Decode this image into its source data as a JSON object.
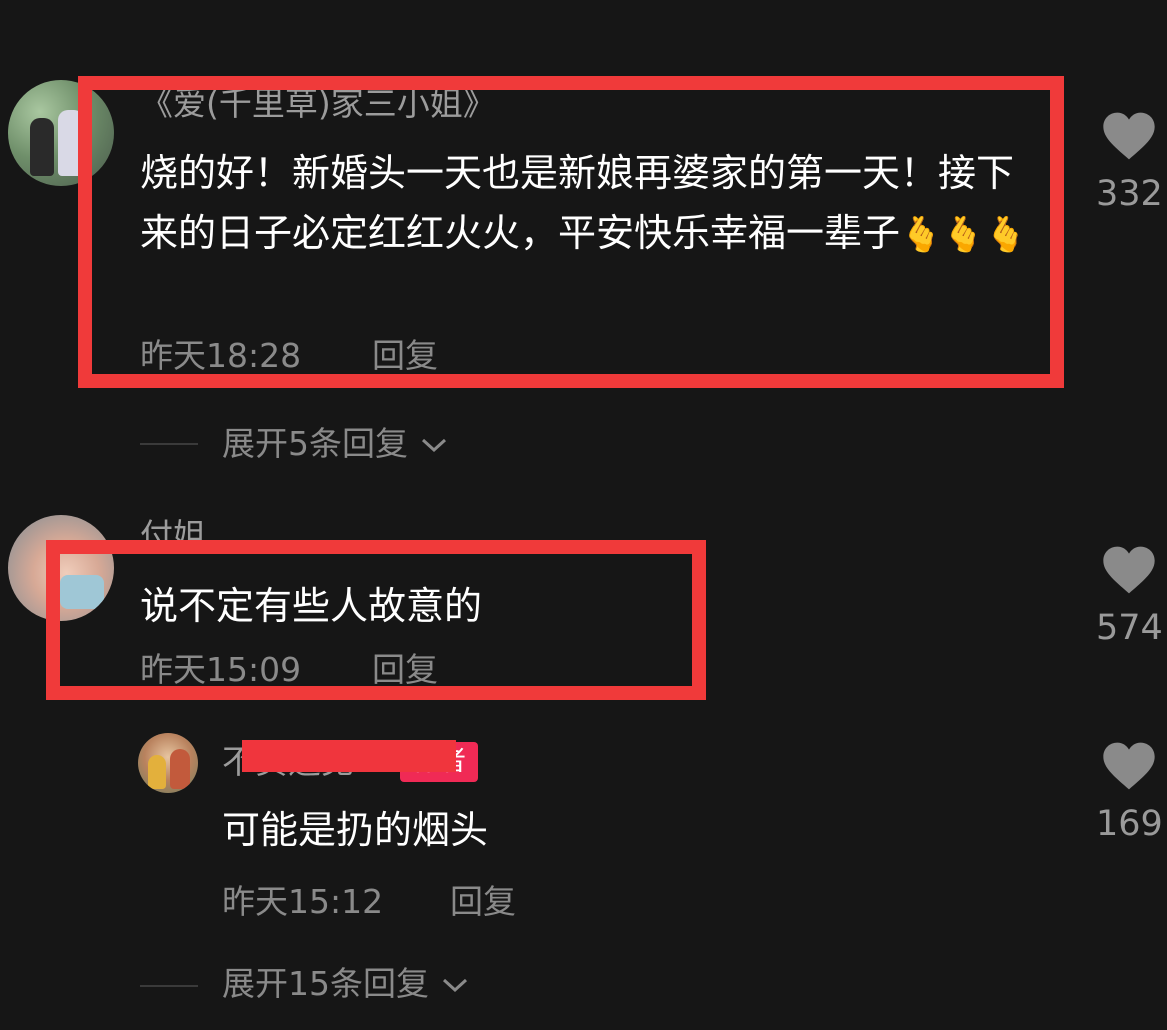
{
  "comments": [
    {
      "username": "《爱(千里草)家三小姐》",
      "text": "烧的好！新婚头一天也是新娘再婆家的第一天！接下来的日子必定红红火火，平安快乐幸福一辈子",
      "emoji": "🫰🫰🫰",
      "time": "昨天18:28",
      "reply": "回复",
      "likes": "332",
      "expand": "展开5条回复"
    },
    {
      "username": "付姐",
      "text": "说不定有些人故意的",
      "time": "昨天15:09",
      "reply": "回复",
      "likes": "574",
      "replies": [
        {
          "username": "不负遇见",
          "tag": "作者",
          "text": "可能是扔的烟头",
          "time": "昨天15:12",
          "reply": "回复",
          "likes": "169"
        }
      ],
      "expand": "展开15条回复"
    }
  ],
  "icons": {
    "like": "heart-icon",
    "expand": "chevron-down-icon"
  },
  "colors": {
    "background": "#161616",
    "highlight": "#f03a3a",
    "author_tag": "#f02a55"
  }
}
